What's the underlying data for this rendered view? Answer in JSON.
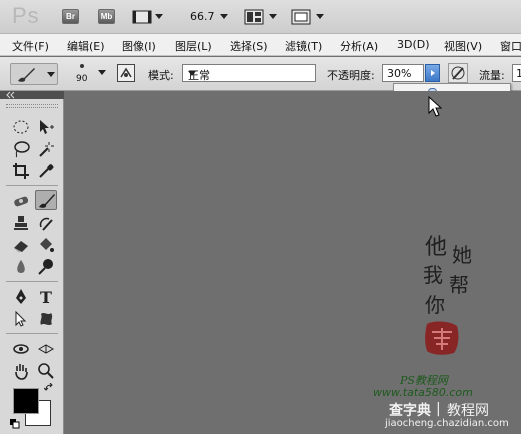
{
  "appbar": {
    "logo": "Ps",
    "bridge_label": "Br",
    "minibridge_label": "Mb",
    "zoom": "66.7"
  },
  "menu": [
    "文件(F)",
    "编辑(E)",
    "图像(I)",
    "图层(L)",
    "选择(S)",
    "滤镜(T)",
    "分析(A)",
    "3D(D)",
    "视图(V)",
    "窗口"
  ],
  "options": {
    "brush_size": "90",
    "mode_label": "模式:",
    "mode_value": "正常",
    "opacity_label": "不透明度:",
    "opacity_value": "30%",
    "flow_label": "流量:",
    "flow_value": "1"
  },
  "opacity_slider": {
    "value_percent": 30
  },
  "watermark": {
    "poem": [
      "他",
      "她",
      "我",
      "帮",
      "你"
    ],
    "site_label": "PS教程网",
    "site_url": "www.tata580.com",
    "footer_name": "查字典",
    "footer_sub": "教程网",
    "footer_url": "jiaocheng.chazidian.com"
  },
  "colors": {
    "foreground": "#000000",
    "background": "#ffffff",
    "slider_accent": "#3b78c8"
  }
}
